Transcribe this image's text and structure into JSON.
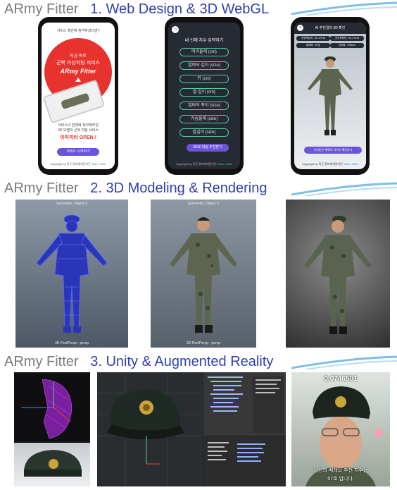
{
  "sections": [
    {
      "brand": "ARmy Fitter",
      "title": "1. Web Design & 3D WebGL"
    },
    {
      "brand": "ARmy Fitter",
      "title": "2. 3D Modeling & Rendering"
    },
    {
      "brand": "ARmy Fitter",
      "title": "3. Unity & Augmented Reality"
    }
  ],
  "phone1": {
    "top_text": "서비스 제안에 참석하셨다면?",
    "red_line1": "지금 바로",
    "red_line2": "군복 가상피팅 서비스",
    "red_brand": "ARmy Fitter",
    "body1": "서비스의 전체에 체크해주었",
    "body2": "3D 모델의 군복 피팅 서비스",
    "open": "아미피터 OPEN !",
    "button": "서비스 시작하기",
    "footer": "Copyright by 육군 정보체계관리단 ",
    "footer_team": "Team. Fitter"
  },
  "phone2": {
    "heading": "내 신체 치수 입력하기",
    "fields": [
      "머리둘레 (cm)",
      "발바닥 길이 (size)",
      "키 (cm)",
      "팔 길이 (cm)",
      "발바닥 폭이 (size)",
      "가슴둘레 (size)",
      "발길이 (size)"
    ],
    "button": "3D로 피팅 추천받기",
    "footer": "Copyright by 육군 정보체계관리단 ",
    "footer_team": "Team. Fitter"
  },
  "phone3": {
    "heading": "AI 추천결과 3D 확인",
    "chips": [
      "전투복상의 : 90-175-M",
      "전투복하의 : 90-178-M",
      "베레모 : 57호",
      "전투화 : 275mm"
    ],
    "button": "추천받은 체육복 사이즈 확인하기",
    "footer": "Copyright by 육군 정보체계관리단 ",
    "footer_team": "Team. Fitter"
  },
  "render_captions": [
    "Symmetry: Object X",
    "Symmetry: Object X",
    "3D Peri/Persp - persp",
    "3D Peri/Persp - persp"
  ],
  "ar": {
    "score": "0.0746501",
    "subtitle1": "당신의 베레모 추천 치수는",
    "subtitle2": "57호 입니다."
  },
  "colors": {
    "accent": "#2f3fb0",
    "brand_gray": "#7a7a7a",
    "red": "#e8322e",
    "button_purple": "#6a55d8",
    "mint": "#4fd0a0"
  }
}
